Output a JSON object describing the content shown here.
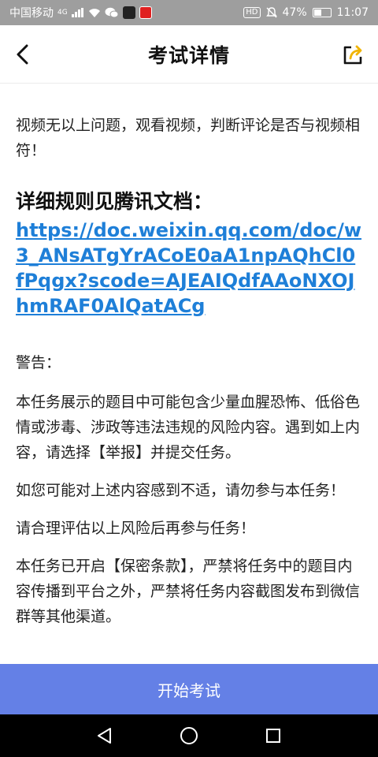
{
  "status_bar": {
    "carrier": "中国移动",
    "network": "4G",
    "hd": "HD",
    "battery": "47%",
    "battery_level": 0.47,
    "time": "11:07"
  },
  "header": {
    "title": "考试详情"
  },
  "content": {
    "intro": "视频无以上问题，观看视频，判断评论是否与视频相符！",
    "rules_title": "详细规则见腾讯文档：",
    "link": "https://doc.weixin.qq.com/doc/w3_ANsATgYrACoE0aA1npAQhCl0fPqgx?scode=AJEAIQdfAAoNXOJhmRAF0AlQatACg",
    "warning_title": "警告：",
    "paragraphs": [
      "本任务展示的题目中可能包含少量血腥恐怖、低俗色情或涉毒、涉政等违法违规的风险内容。遇到如上内容，请选择【举报】并提交任务。",
      "如您可能对上述内容感到不适，请勿参与本任务！",
      "请合理评估以上风险后再参与任务！",
      "本任务已开启【保密条款】，严禁将任务中的题目内容传播到平台之外，严禁将任务内容截图发布到微信群等其他渠道。"
    ]
  },
  "actions": {
    "start_label": "开始考试"
  },
  "colors": {
    "status_bar_bg": "#9e9e9e",
    "link": "#1e7fd8",
    "start_button_bg": "#6480e6",
    "nav_bar_bg": "#000000"
  }
}
